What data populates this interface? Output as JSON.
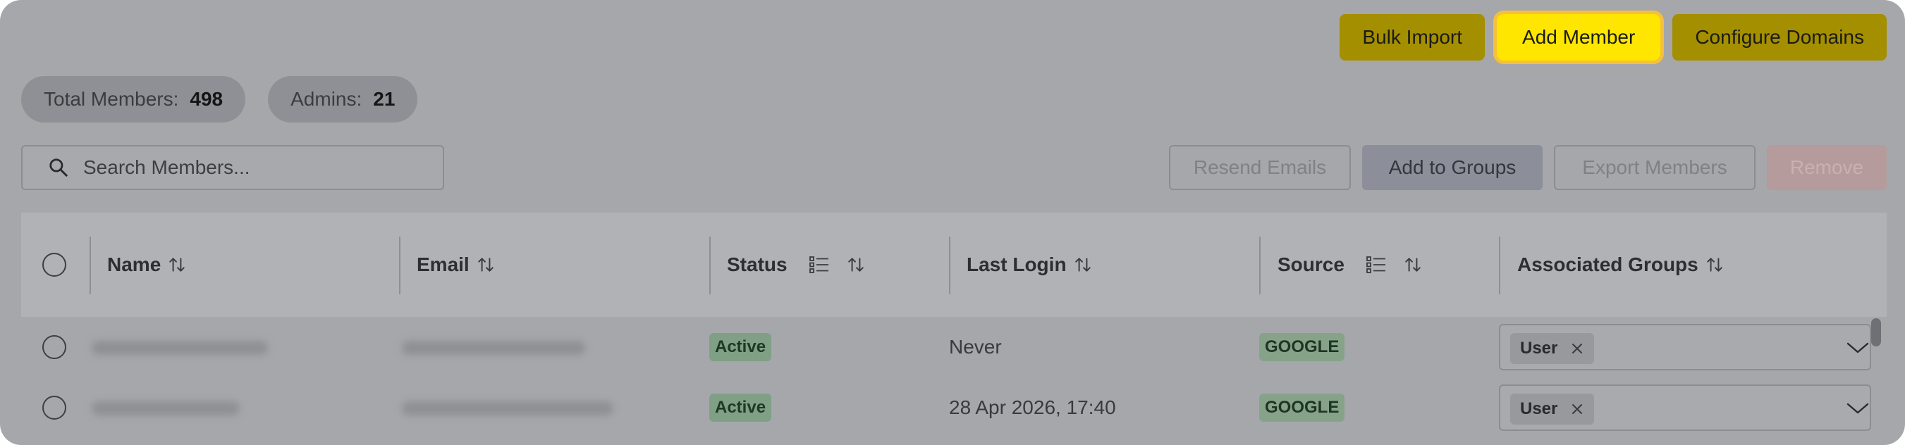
{
  "top_actions": {
    "bulk_import": "Bulk Import",
    "add_member": "Add Member",
    "configure_domains": "Configure Domains"
  },
  "stats": {
    "total_label": "Total Members:",
    "total_value": "498",
    "admins_label": "Admins:",
    "admins_value": "21"
  },
  "search": {
    "placeholder": "Search Members..."
  },
  "secondary_actions": {
    "resend": "Resend Emails",
    "add_to_groups": "Add to Groups",
    "export": "Export Members",
    "remove": "Remove"
  },
  "table": {
    "columns": {
      "name": "Name",
      "email": "Email",
      "status": "Status",
      "last_login": "Last Login",
      "source": "Source",
      "groups": "Associated Groups"
    },
    "rows": [
      {
        "status": "Active",
        "last_login": "Never",
        "source": "GOOGLE",
        "group": "User"
      },
      {
        "status": "Active",
        "last_login": "28 Apr 2026, 17:40",
        "source": "GOOGLE",
        "group": "User"
      }
    ]
  },
  "colors": {
    "overlay": "#a6a7ab",
    "highlight": "#ffe600",
    "highlight_ring": "#f4c13a",
    "dim_primary": "#a48f00",
    "status_active": "#7fa085"
  },
  "icons": [
    "search-icon",
    "sort-icon",
    "filter-list-icon",
    "remove-x-icon",
    "chevron-down-icon"
  ]
}
